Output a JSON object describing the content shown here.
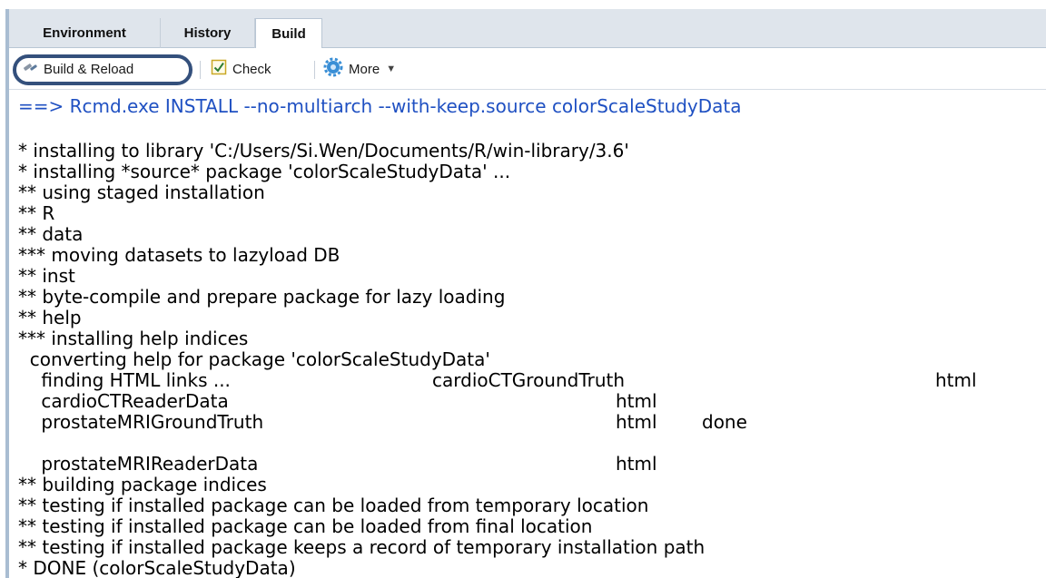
{
  "tabs": {
    "environment": "Environment",
    "history": "History",
    "build": "Build"
  },
  "toolbar": {
    "build_reload_label": "Build & Reload",
    "check_label": "Check",
    "more_label": "More"
  },
  "console": {
    "command": "==> Rcmd.exe INSTALL --no-multiarch --with-keep.source colorScaleStudyData",
    "lines": [
      "* installing to library 'C:/Users/Si.Wen/Documents/R/win-library/3.6'",
      "* installing *source* package 'colorScaleStudyData' ...",
      "** using staged installation",
      "** R",
      "** data",
      "*** moving datasets to lazyload DB",
      "** inst",
      "** byte-compile and prepare package for lazy loading",
      "** help",
      "*** installing help indices",
      "  converting help for package 'colorScaleStudyData'"
    ],
    "help_rows": {
      "r1_a": "    finding HTML links ...",
      "r1_b": "cardioCTGroundTruth",
      "r1_c": "html",
      "r2_a": "    cardioCTReaderData",
      "r2_b": "html",
      "r3_a": "    prostateMRIGroundTruth",
      "r3_b": "html",
      "r3_c": "done",
      "r4_a": "    prostateMRIReaderData",
      "r4_b": "html"
    },
    "tail_lines": [
      "** building package indices",
      "** testing if installed package can be loaded from temporary location",
      "** testing if installed package can be loaded from final location",
      "** testing if installed package keeps a record of temporary installation path",
      "* DONE (colorScaleStudyData)"
    ]
  },
  "colors": {
    "command": "#1f50c2",
    "highlight_ring": "#34507c",
    "tab_bar": "#dfe5ec"
  },
  "icons": {
    "build": "hammer-icon",
    "check": "checkbox-icon",
    "more": "gear-icon",
    "more_dropdown": "chevron-down-icon"
  }
}
